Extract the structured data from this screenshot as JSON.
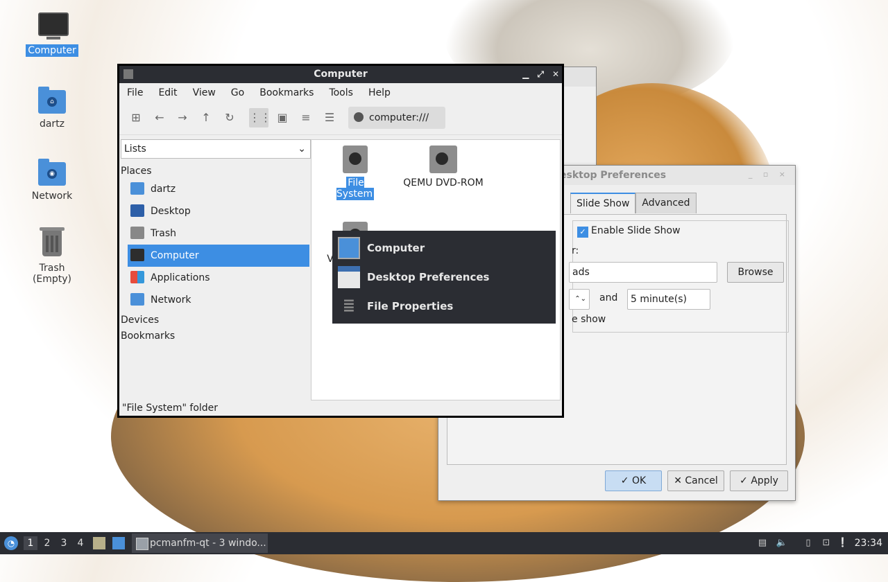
{
  "desktop": {
    "icons": [
      {
        "label": "Computer",
        "icon": "monitor-icon"
      },
      {
        "label": "dartz",
        "icon": "home-folder-icon"
      },
      {
        "label": "Network",
        "icon": "network-folder-icon"
      },
      {
        "label": "Trash (Empty)",
        "icon": "trash-icon"
      }
    ]
  },
  "prefs": {
    "title": "esktop Preferences",
    "tabs": [
      "Slide Show",
      "Advanced"
    ],
    "enable_label": "Enable Slide Show",
    "folder_label_partial": "r:",
    "folder_value_partial": "ads",
    "browse_label": "Browse",
    "and_label": "and",
    "interval_value": "5 minute(s)",
    "shuffle_partial": "e show",
    "ok_label": "OK",
    "cancel_label": "Cancel",
    "apply_label": "Apply"
  },
  "main": {
    "title": "Computer",
    "menu": [
      "File",
      "Edit",
      "View",
      "Go",
      "Bookmarks",
      "Tools",
      "Help"
    ],
    "address": "computer:///",
    "side_select": "Lists",
    "places_header": "Places",
    "places": [
      {
        "label": "dartz",
        "icon": "home-folder-icon"
      },
      {
        "label": "Desktop",
        "icon": "desktop-icon"
      },
      {
        "label": "Trash",
        "icon": "trash-icon"
      },
      {
        "label": "Computer",
        "icon": "computer-icon"
      },
      {
        "label": "Applications",
        "icon": "applications-icon"
      },
      {
        "label": "Network",
        "icon": "network-icon"
      }
    ],
    "devices_header": "Devices",
    "bookmarks_header": "Bookmarks",
    "files": [
      {
        "label": "File System",
        "icon": "drive-icon"
      },
      {
        "label": "QEMU DVD-ROM",
        "icon": "optical-drive-icon"
      },
      {
        "label": "V",
        "icon": "drive-icon"
      }
    ],
    "status": "\"File System\" folder"
  },
  "switcher": {
    "items": [
      {
        "label": "Computer",
        "icon": "folder-window-icon"
      },
      {
        "label": "Desktop Preferences",
        "icon": "window-icon"
      },
      {
        "label": "File Properties",
        "icon": "list-icon"
      }
    ]
  },
  "taskbar": {
    "workspaces": [
      "1",
      "2",
      "3",
      "4"
    ],
    "task_label": "pcmanfm-qt - 3 windo...",
    "clock": "23:34"
  },
  "colors": {
    "accent": "#3d8ee3",
    "titlebar": "#2b2d33",
    "folder": "#4a90d9"
  }
}
